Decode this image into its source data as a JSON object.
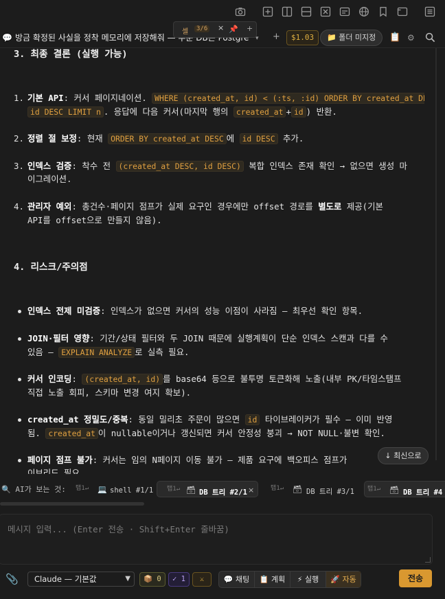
{
  "toolbar": {
    "icons": [
      "camera-icon",
      "add-pane-icon",
      "split-vertical-icon",
      "split-horizontal-icon",
      "close-pane-icon",
      "subtitles-icon",
      "globe-icon",
      "bookmark-icon",
      "window-icon",
      "menu-icon"
    ]
  },
  "tabbar": {
    "session_title": "방금 확정된 사실을 정착 메모리에 저장해줘 — 주문 DB는 Postgre",
    "cell_label": "셀",
    "cell_count": "3/6",
    "cost": "$1.03",
    "folder_button": "📁 폴더 미지정"
  },
  "content": {
    "conclusion_heading": "3. 최종 결론 (실행 가능)",
    "items": [
      {
        "num": "1.",
        "bold": "기본 API",
        "text1": ": 커서 페이지네이션. ",
        "code1": "WHERE (created_at, id) < (:ts, :id) ORDER BY created_at DESC,",
        "code1b": "id DESC LIMIT n",
        "text2": ". 응답에 다음 커서(마지막 행의 ",
        "code2": "created_at",
        "plus": "+",
        "code3": "id",
        "text3": ") 반환."
      },
      {
        "num": "2.",
        "bold": "정렬 절 보정",
        "text1": ": 현재 ",
        "code1": "ORDER BY created_at DESC",
        "text2": "에 ",
        "code2": "id DESC",
        "text3": " 추가."
      },
      {
        "num": "3.",
        "bold": "인덱스 검증",
        "text1": ": 착수 전 ",
        "code1": "(created_at DESC, id DESC)",
        "text2": " 복합 인덱스 존재 확인 → 없으면 생성 마",
        "line2": "이그레이션."
      },
      {
        "num": "4.",
        "bold": "관리자 예외",
        "text1": ": 총건수·페이지 점프가 실제 요구인 경우에만 offset 경로를 ",
        "bold2": "별도로",
        "text2": " 제공(기본",
        "line2": "API를 offset으로 만들지 않음)."
      }
    ],
    "risk_heading": "4. 리스크/주의점",
    "risks": [
      {
        "bold": "인덱스 전제 미검증",
        "text1": ": 인덱스가 없으면 커서의 성능 이점이 사라짐 — 최우선 확인 항목."
      },
      {
        "bold": "JOIN·필터 영향",
        "text1": ": 기간/상태 필터와 두 JOIN 때문에 실행계획이 단순 인덱스 스캔과 다를 수",
        "line2a": "있음 — ",
        "code1": "EXPLAIN ANALYZE",
        "line2b": "로 실측 필요."
      },
      {
        "bold": "커서 인코딩",
        "text1": ": ",
        "code1": "(created_at, id)",
        "text2": "를 base64 등으로 불투명 토큰화해 노출(내부 PK/타임스탬프",
        "line2": "직접 노출 회피, 스키마 변경 여지 확보)."
      },
      {
        "bold": "created_at 정밀도/중복",
        "text1": ": 동일 밀리초 주문이 많으면 ",
        "code1": "id",
        "text2": " 타이브레이커가 필수 — 이미 반영",
        "line2a": "됨. ",
        "code2": "created_at",
        "line2b": "이 nullable이거나 갱신되면 커서 안정성 붕괴 → NOT NULL·불변 확인."
      },
      {
        "bold": "페이지 점프 불가",
        "text1": ": 커서는 임의 N페이지 이동 불가 — 제품 요구에 백오피스 점프가 ",
        "line2": "이브리드 필요."
      }
    ],
    "latest_button": "↓ 최신으로"
  },
  "watch": {
    "label": "🔍 AI가 보는 것:",
    "terminals": [
      {
        "key": "탭1↵",
        "name": "shell #1/1",
        "active": false
      },
      {
        "key": "탭1↵",
        "name": "DB 트리 #2/1",
        "active": true
      },
      {
        "key": "탭1↵",
        "name": "DB 트리 #3/1",
        "active": false
      },
      {
        "key": "탭1↵",
        "name": "DB 트리 #4",
        "active": true
      }
    ]
  },
  "composer": {
    "placeholder": "메시지 입력... (Enter 전송 · Shift+Enter 줄바꿈)",
    "model": "Claude — 기본값",
    "memory_pill": "📦 0",
    "version_pill": "✓ 1",
    "tools_pill": "⚔",
    "modes": [
      "💬 채팅",
      "📋 계획",
      "⚡ 실행",
      "🚀 자동"
    ],
    "active_mode": "🚀 자동",
    "send": "전송"
  }
}
